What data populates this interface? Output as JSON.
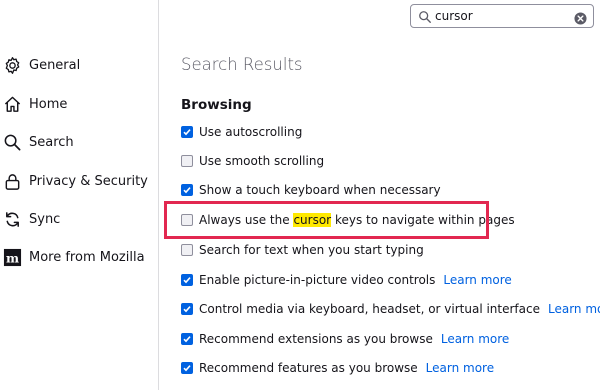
{
  "sidebar": {
    "items": [
      {
        "label": "General",
        "icon": "gear-icon"
      },
      {
        "label": "Home",
        "icon": "home-icon"
      },
      {
        "label": "Search",
        "icon": "search-icon"
      },
      {
        "label": "Privacy & Security",
        "icon": "lock-icon"
      },
      {
        "label": "Sync",
        "icon": "sync-icon"
      },
      {
        "label": "More from Mozilla",
        "icon": "mozilla-icon"
      }
    ]
  },
  "search": {
    "value": "cursor"
  },
  "main": {
    "results_title": "Search Results",
    "section_title": "Browsing",
    "learn_more": "Learn more",
    "rows": [
      {
        "pre": "Use ",
        "hl": "",
        "post": "autoscrolling",
        "checked": true
      },
      {
        "pre": "Use smooth scrolling",
        "hl": "",
        "post": "",
        "checked": false
      },
      {
        "pre": "Show a touch keyboard when necessary",
        "hl": "",
        "post": "",
        "checked": true
      },
      {
        "pre": "Always use the ",
        "hl": "cursor",
        "post": " keys to navigate within pages",
        "checked": false
      },
      {
        "pre": "Search for text when you start typing",
        "hl": "",
        "post": "",
        "checked": false
      },
      {
        "pre": "Enable picture-in-picture video controls",
        "hl": "",
        "post": "",
        "checked": true
      },
      {
        "pre": "Control media via keyboard, headset, or virtual interface",
        "hl": "",
        "post": "",
        "checked": true
      },
      {
        "pre": "Recommend extensions as you browse",
        "hl": "",
        "post": "",
        "checked": true
      },
      {
        "pre": "Recommend features as you browse",
        "hl": "",
        "post": "",
        "checked": true
      }
    ]
  },
  "colors": {
    "accent": "#0061e0",
    "highlight": "#ffe900",
    "annotation": "#e22850"
  }
}
